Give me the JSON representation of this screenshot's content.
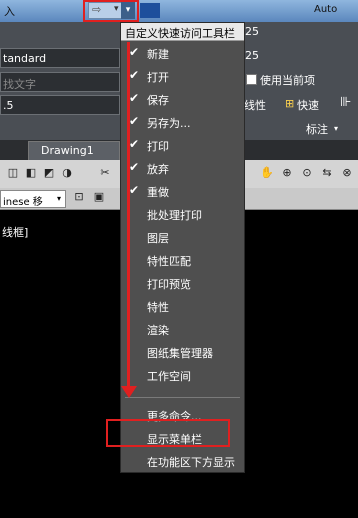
{
  "title_bar": {
    "left_text": "入",
    "redo_icon": "redo-arrow",
    "dropdown_glyph": "▾",
    "right_text": "Auto"
  },
  "left_ribbon": {
    "style_value": "tandard",
    "search_placeholder": "找文字",
    "size_value": ".5",
    "panel_label": "文字",
    "panel_arrow": "▾"
  },
  "tabs": {
    "drawing_tab": "Drawing1"
  },
  "toolbar": {
    "language_value": "inese 移",
    "language_arrow": "▾"
  },
  "canvas": {
    "viewport_label": "线框]"
  },
  "right_ribbon": {
    "value_a": "25",
    "value_b": "25",
    "use_current_label": "使用当前项",
    "linetype_label": "线性",
    "quick_label": "快速",
    "dimension_label": "标注",
    "dimension_arrow": "▾"
  },
  "menu": {
    "header": "自定义快速访问工具栏",
    "items": [
      {
        "label": "新建",
        "checked": true
      },
      {
        "label": "打开",
        "checked": true
      },
      {
        "label": "保存",
        "checked": true
      },
      {
        "label": "另存为...",
        "checked": true
      },
      {
        "label": "打印",
        "checked": true
      },
      {
        "label": "放弃",
        "checked": true
      },
      {
        "label": "重做",
        "checked": true
      },
      {
        "label": "批处理打印",
        "checked": false
      },
      {
        "label": "图层",
        "checked": false
      },
      {
        "label": "特性匹配",
        "checked": false
      },
      {
        "label": "打印预览",
        "checked": false
      },
      {
        "label": "特性",
        "checked": false
      },
      {
        "label": "渲染",
        "checked": false
      },
      {
        "label": "图纸集管理器",
        "checked": false
      },
      {
        "label": "工作空间",
        "checked": false
      }
    ],
    "more_commands": "更多命令...",
    "show_menubar": "显示菜单栏",
    "show_below_ribbon": "在功能区下方显示",
    "check_glyph": "✔"
  },
  "colors": {
    "annotation_red": "#e02020",
    "menu_bg": "#4f4f4f",
    "ribbon_bg": "#4a4e54",
    "title_blue": "#5b87bd"
  }
}
